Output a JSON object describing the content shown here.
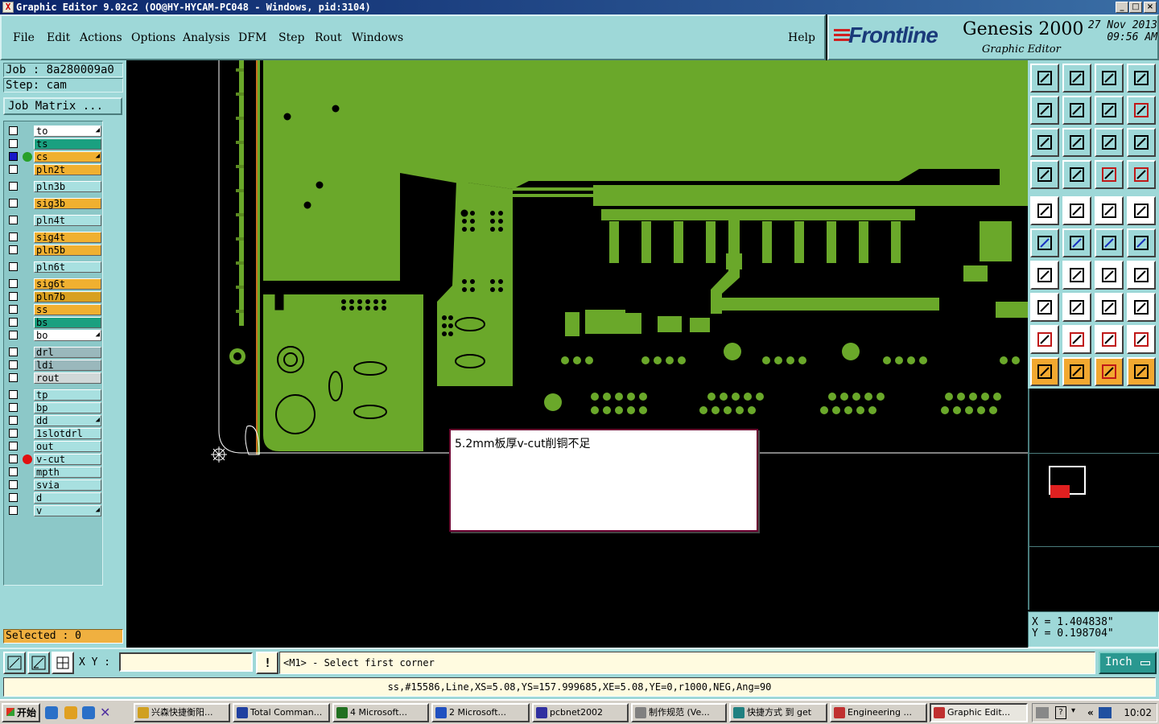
{
  "window": {
    "title": "Graphic Editor 9.02c2  (OO@HY-HYCAM-PC048 - Windows, pid:3104)",
    "icon_glyph": "X",
    "minimize": "_",
    "maximize": "□",
    "close": "×"
  },
  "menu": {
    "items": [
      "File",
      "Edit",
      "Actions",
      "Options",
      "Analysis",
      "DFM",
      "Step",
      "Rout",
      "Windows"
    ],
    "help": "Help"
  },
  "logo": {
    "brand": "Frontline",
    "product": "Genesis 2000",
    "subtitle": "Graphic Editor",
    "date": "27 Nov 2013",
    "time": "09:56 AM"
  },
  "job": {
    "job_label": "Job : 8a280009a0",
    "step_label": "Step: cam",
    "matrix_button": "Job Matrix ..."
  },
  "layers": [
    {
      "name": "to",
      "color": "#ffffff",
      "checked": false,
      "arrow": true
    },
    {
      "name": "ts",
      "color": "#1aa080",
      "checked": false,
      "arrow": false
    },
    {
      "name": "cs",
      "color": "#f0b030",
      "checked": true,
      "arrow": true,
      "dot": "#28a028"
    },
    {
      "name": "pln2t",
      "color": "#f0b030",
      "checked": false,
      "arrow": false
    },
    {
      "name": "pln3b",
      "color": "#a8e0e0",
      "checked": false,
      "arrow": false
    },
    {
      "name": "sig3b",
      "color": "#f0b030",
      "checked": false,
      "arrow": false
    },
    {
      "name": "pln4t",
      "color": "#a8e0e0",
      "checked": false,
      "arrow": false
    },
    {
      "name": "sig4t",
      "color": "#f0b030",
      "checked": false,
      "arrow": false
    },
    {
      "name": "pln5b",
      "color": "#f0b030",
      "checked": false,
      "arrow": false
    },
    {
      "name": "pln6t",
      "color": "#a8e0e0",
      "checked": false,
      "arrow": false
    },
    {
      "name": "sig6t",
      "color": "#f0b030",
      "checked": false,
      "arrow": false
    },
    {
      "name": "pln7b",
      "color": "#d8a020",
      "checked": false,
      "arrow": false
    },
    {
      "name": "ss",
      "color": "#f0b030",
      "checked": false,
      "arrow": false
    },
    {
      "name": "bs",
      "color": "#1aa080",
      "checked": false,
      "arrow": false
    },
    {
      "name": "bo",
      "color": "#ffffff",
      "checked": false,
      "arrow": true
    },
    {
      "name": "drl",
      "color": "#9ab8bc",
      "checked": false,
      "arrow": false
    },
    {
      "name": "ldi",
      "color": "#9ab8bc",
      "checked": false,
      "arrow": false
    },
    {
      "name": "rout",
      "color": "#d0d8d8",
      "checked": false,
      "arrow": false
    },
    {
      "name": "tp",
      "color": "#a8e0e0",
      "checked": false,
      "arrow": false
    },
    {
      "name": "bp",
      "color": "#a8e0e0",
      "checked": false,
      "arrow": false
    },
    {
      "name": "dd",
      "color": "#a8e0e0",
      "checked": false,
      "arrow": true
    },
    {
      "name": "1slotdrl",
      "color": "#a8e0e0",
      "checked": false,
      "arrow": false
    },
    {
      "name": "out",
      "color": "#a8e0e0",
      "checked": false,
      "arrow": false
    },
    {
      "name": "v-cut",
      "color": "#a8e0e0",
      "checked": false,
      "arrow": false,
      "dot": "#e01010"
    },
    {
      "name": "mpth",
      "color": "#a8e0e0",
      "checked": false,
      "arrow": false
    },
    {
      "name": "svia",
      "color": "#a8e0e0",
      "checked": false,
      "arrow": false
    },
    {
      "name": "d",
      "color": "#a8e0e0",
      "checked": false,
      "arrow": false
    },
    {
      "name": "v",
      "color": "#a8e0e0",
      "checked": false,
      "arrow": true
    }
  ],
  "selected": "Selected : 0",
  "comment": "5.2mm板厚v-cut削铜不足",
  "coords": {
    "x": "X = 1.404838\"",
    "y": "Y = 0.198704\""
  },
  "command": {
    "xy_label": "X Y :",
    "xy_value": "",
    "bang": "!",
    "prompt": "<M1> - Select first corner",
    "unit": "Inch"
  },
  "info": "ss,#15586,Line,XS=5.08,YS=157.999685,XE=5.08,YE=0,r1000,NEG,Ang=90",
  "taskbar": {
    "start": "开始",
    "tasks": [
      {
        "label": "兴森快捷衡阳...",
        "icon": "#d0a020"
      },
      {
        "label": "Total Comman...",
        "icon": "#2040a0"
      },
      {
        "label": "4 Microsoft...",
        "icon": "#207020"
      },
      {
        "label": "2 Microsoft...",
        "icon": "#2050c0"
      },
      {
        "label": "pcbnet2002",
        "icon": "#3030a0"
      },
      {
        "label": "制作规范 (Ve...",
        "icon": "#808080"
      },
      {
        "label": "快捷方式 到 get",
        "icon": "#208080"
      },
      {
        "label": "Engineering ...",
        "icon": "#c03030"
      },
      {
        "label": "Graphic Edit...",
        "icon": "#c03030"
      }
    ],
    "clock": "10:02",
    "tray_chevron": "«"
  }
}
